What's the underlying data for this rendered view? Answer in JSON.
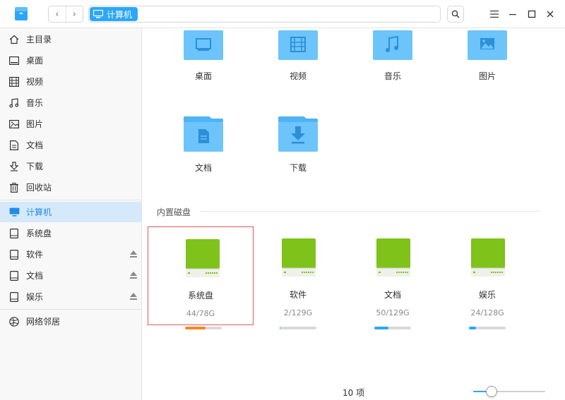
{
  "titlebar": {
    "location": "计算机",
    "back_icon": "chevron-left",
    "forward_icon": "chevron-right"
  },
  "sidebar": {
    "items": [
      {
        "label": "主目录",
        "icon": "home-icon"
      },
      {
        "label": "桌面",
        "icon": "desktop-icon"
      },
      {
        "label": "视频",
        "icon": "video-icon"
      },
      {
        "label": "音乐",
        "icon": "music-icon"
      },
      {
        "label": "图片",
        "icon": "picture-icon"
      },
      {
        "label": "文档",
        "icon": "document-icon"
      },
      {
        "label": "下载",
        "icon": "download-icon"
      },
      {
        "label": "回收站",
        "icon": "trash-icon"
      }
    ],
    "devices": [
      {
        "label": "计算机",
        "icon": "computer-icon",
        "active": true
      },
      {
        "label": "系统盘",
        "icon": "disk-icon"
      },
      {
        "label": "软件",
        "icon": "disk-icon",
        "eject": true
      },
      {
        "label": "文档",
        "icon": "disk-icon",
        "eject": true
      },
      {
        "label": "娱乐",
        "icon": "disk-icon",
        "eject": true
      }
    ],
    "network": {
      "label": "网络邻居",
      "icon": "network-icon"
    }
  },
  "folders": [
    {
      "label": "桌面",
      "icon": "desktop-icon"
    },
    {
      "label": "视频",
      "icon": "video-icon"
    },
    {
      "label": "音乐",
      "icon": "music-icon"
    },
    {
      "label": "图片",
      "icon": "picture-icon"
    },
    {
      "label": "文档",
      "icon": "document-icon"
    },
    {
      "label": "下载",
      "icon": "download-icon"
    }
  ],
  "disk_section": {
    "title": "内置磁盘"
  },
  "disks": [
    {
      "name": "系统盘",
      "size": "44/78G",
      "usage": 0.564,
      "bar_color": "#f08a24",
      "selected": true
    },
    {
      "name": "软件",
      "size": "2/129G",
      "usage": 0.016,
      "bar_color": "#2ca7f8"
    },
    {
      "name": "文档",
      "size": "50/129G",
      "usage": 0.388,
      "bar_color": "#2ca7f8"
    },
    {
      "name": "娱乐",
      "size": "24/128G",
      "usage": 0.188,
      "bar_color": "#2ca7f8"
    }
  ],
  "status": {
    "item_count": "10 项"
  },
  "zoom": {
    "level": 0.25
  },
  "colors": {
    "accent": "#2ca7f8",
    "folder": "#6cc4fb",
    "disk_green": "#7ec21a"
  }
}
